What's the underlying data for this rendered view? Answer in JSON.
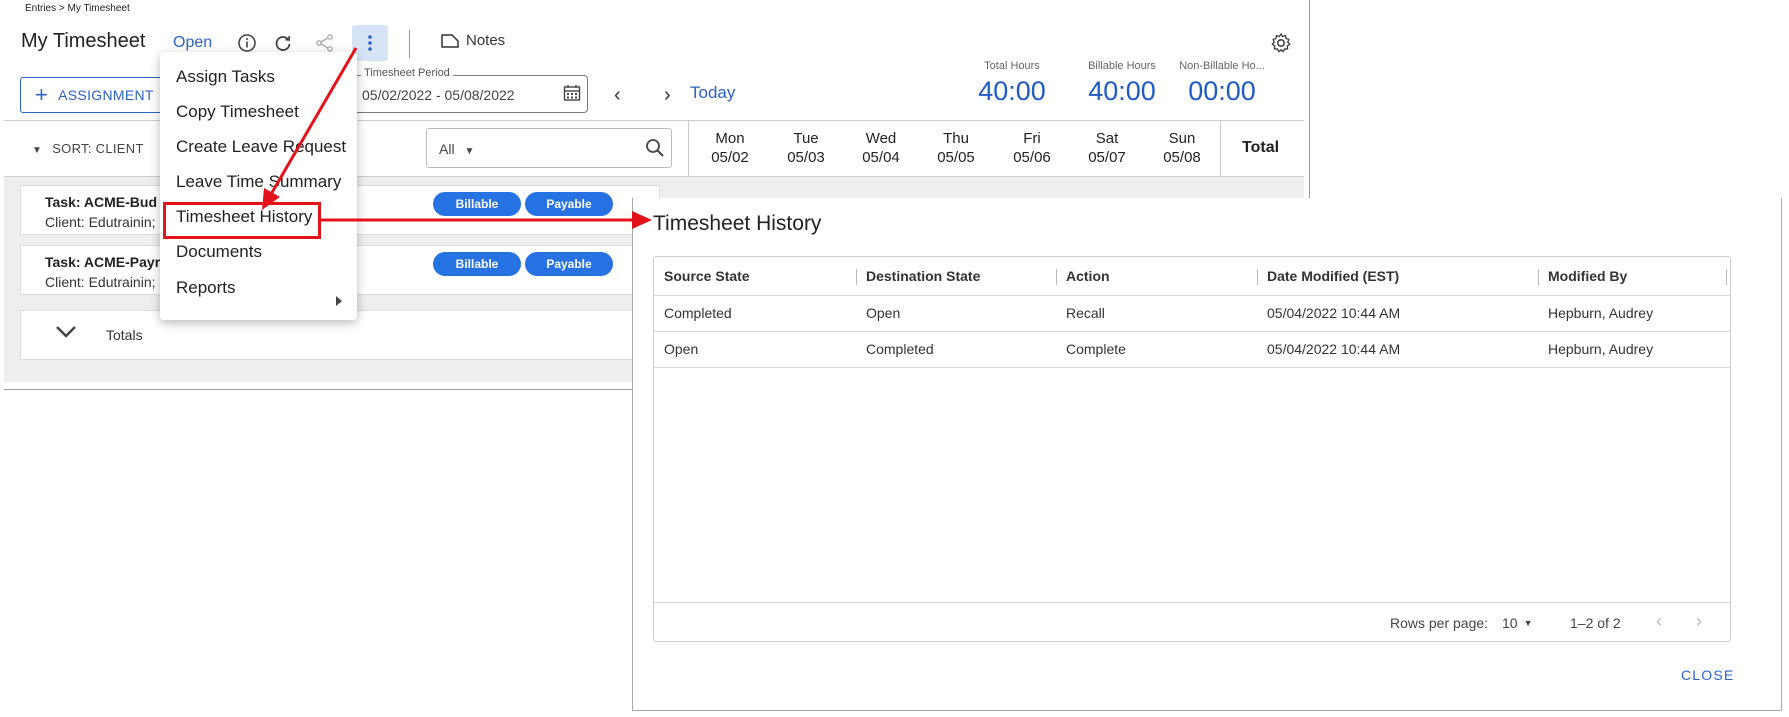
{
  "breadcrumb": "Entries > My Timesheet",
  "header": {
    "title": "My Timesheet",
    "status": "Open",
    "notes_label": "Notes"
  },
  "toolbar": {
    "assignment_label": "ASSIGNMENT",
    "period_label": "Timesheet Period",
    "period_value": "05/02/2022 - 05/08/2022",
    "today_label": "Today"
  },
  "summary": [
    {
      "label": "Total Hours",
      "value": "40:00"
    },
    {
      "label": "Billable Hours",
      "value": "40:00"
    },
    {
      "label": "Non-Billable Ho...",
      "value": "00:00"
    }
  ],
  "grid": {
    "sort_label": "SORT: CLIENT",
    "filter_value": "All",
    "days": [
      {
        "day": "Mon",
        "date": "05/02"
      },
      {
        "day": "Tue",
        "date": "05/03"
      },
      {
        "day": "Wed",
        "date": "05/04"
      },
      {
        "day": "Thu",
        "date": "05/05"
      },
      {
        "day": "Fri",
        "date": "05/06"
      },
      {
        "day": "Sat",
        "date": "05/07"
      },
      {
        "day": "Sun",
        "date": "05/08"
      }
    ],
    "total_label": "Total",
    "tasks": [
      {
        "name": "Task: ACME-Bud",
        "client": "Client: Edutrainin;",
        "badges": [
          "Billable",
          "Payable"
        ]
      },
      {
        "name": "Task: ACME-Payr",
        "client": "Client: Edutrainin;",
        "badges": [
          "Billable",
          "Payable"
        ]
      }
    ],
    "totals_label": "Totals"
  },
  "menu": {
    "items": [
      "Assign Tasks",
      "Copy Timesheet",
      "Create Leave Request",
      "Leave Time Summary",
      "Timesheet History",
      "Documents",
      "Reports"
    ],
    "highlighted": "Timesheet History"
  },
  "dialog": {
    "title": "Timesheet History",
    "columns": [
      "Source State",
      "Destination State",
      "Action",
      "Date Modified (EST)",
      "Modified By"
    ],
    "rows": [
      [
        "Completed",
        "Open",
        "Recall",
        "05/04/2022 10:44 AM",
        "Hepburn, Audrey"
      ],
      [
        "Open",
        "Completed",
        "Complete",
        "05/04/2022 10:44 AM",
        "Hepburn, Audrey"
      ]
    ],
    "rows_per_page_label": "Rows per page:",
    "rows_per_page_value": "10",
    "range_text": "1–2 of 2",
    "close_label": "CLOSE"
  },
  "colors": {
    "accent": "#2a63c9",
    "badge": "#2672e3",
    "annotation": "#e3121b"
  }
}
